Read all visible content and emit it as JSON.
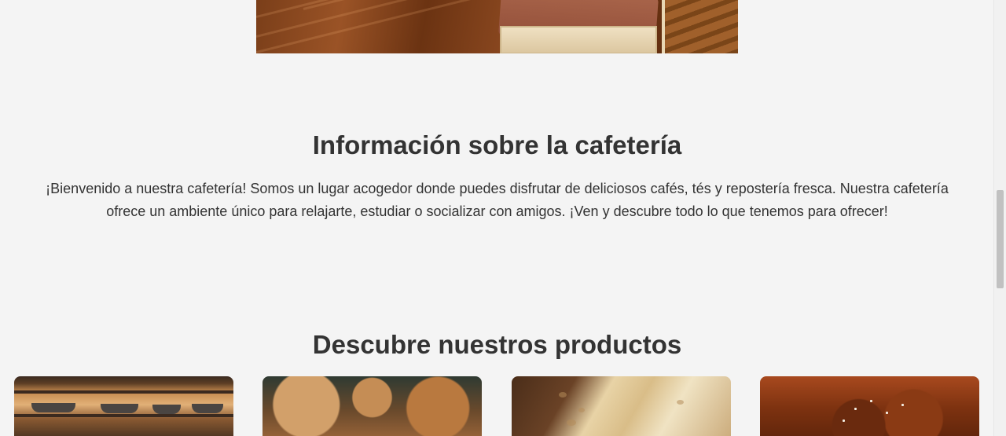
{
  "hero": {
    "image_name": "cafe-interior-photo"
  },
  "info_section": {
    "title": "Información sobre la cafetería",
    "text": "¡Bienvenido a nuestra cafetería! Somos un lugar acogedor donde puedes disfrutar de deliciosos cafés, tés y repostería fresca. Nuestra cafetería ofrece un ambiente único para relajarte, estudiar o socializar con amigos. ¡Ven y descubre todo lo que tenemos para ofrecer!"
  },
  "products_section": {
    "title": "Descubre nuestros productos",
    "products": [
      {
        "image_name": "kitchen-shelf-photo"
      },
      {
        "image_name": "bread-rolls-photo"
      },
      {
        "image_name": "sliced-bread-photo"
      },
      {
        "image_name": "pretzels-photo"
      }
    ]
  },
  "colors": {
    "background": "#f4f4f4",
    "text": "#333333"
  }
}
